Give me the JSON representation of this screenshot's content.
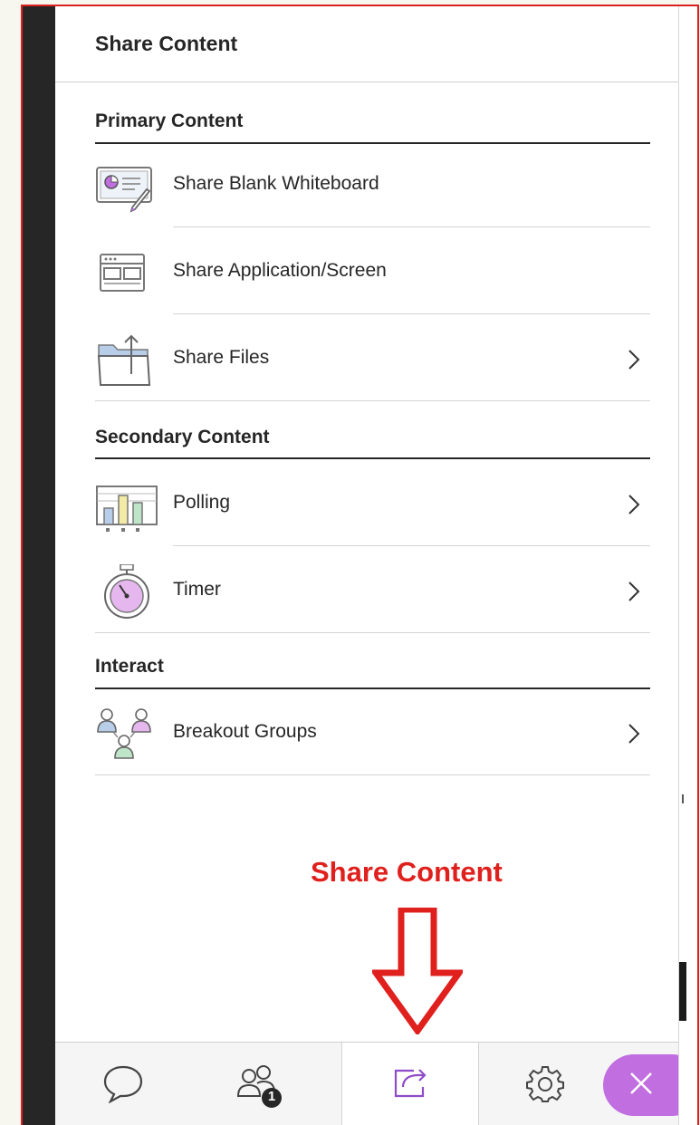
{
  "panel": {
    "title": "Share Content"
  },
  "sections": [
    {
      "title": "Primary Content",
      "items": [
        {
          "label": "Share Blank Whiteboard",
          "icon": "whiteboard-icon",
          "has_chevron": false
        },
        {
          "label": "Share Application/Screen",
          "icon": "application-window-icon",
          "has_chevron": false
        },
        {
          "label": "Share Files",
          "icon": "folder-upload-icon",
          "has_chevron": true
        }
      ]
    },
    {
      "title": "Secondary Content",
      "items": [
        {
          "label": "Polling",
          "icon": "polling-chart-icon",
          "has_chevron": true
        },
        {
          "label": "Timer",
          "icon": "stopwatch-icon",
          "has_chevron": true
        }
      ]
    },
    {
      "title": "Interact",
      "items": [
        {
          "label": "Breakout Groups",
          "icon": "breakout-groups-icon",
          "has_chevron": true
        }
      ]
    }
  ],
  "annotation": {
    "text": "Share Content",
    "color": "#e0201d"
  },
  "bottom_bar": {
    "tabs": [
      {
        "icon": "chat-icon",
        "active": false
      },
      {
        "icon": "attendees-icon",
        "badge": "1",
        "active": false
      },
      {
        "icon": "share-content-icon",
        "active": true
      },
      {
        "icon": "settings-gear-icon",
        "active": false
      }
    ],
    "close_icon": "close-icon",
    "accent_color": "#8e4cc8"
  }
}
